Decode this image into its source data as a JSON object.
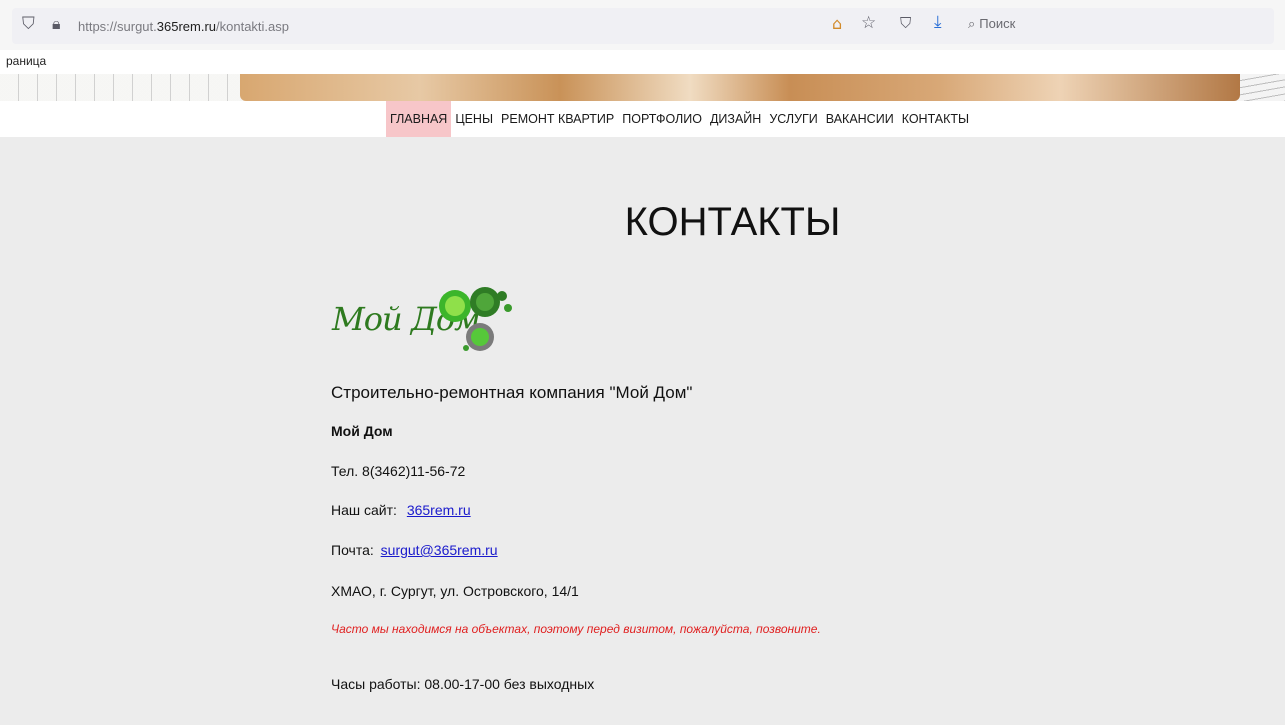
{
  "browser": {
    "url_prefix": "https://surgut.",
    "url_domain": "365rem.ru",
    "url_path": "/kontakti.asp",
    "search_placeholder": "Поиск",
    "tab_fragment": "раница"
  },
  "nav": {
    "items": [
      {
        "label": "ГЛАВНАЯ",
        "active": true
      },
      {
        "label": "ЦЕНЫ"
      },
      {
        "label": "РЕМОНТ КВАРТИР"
      },
      {
        "label": "ПОРТФОЛИО"
      },
      {
        "label": "ДИЗАЙН"
      },
      {
        "label": "УСЛУГИ"
      },
      {
        "label": "ВАКАНСИИ"
      },
      {
        "label": "КОНТАКТЫ"
      }
    ],
    "active_color": "#f7c6c9"
  },
  "page": {
    "title": "КОНТАКТЫ",
    "logo_text": "Мой Дом",
    "company": "Строительно-ремонтная компания \"Мой Дом\"",
    "name": "Мой Дом",
    "phone": "Тел. 8(3462)11-56-72",
    "site_label": "Наш сайт:",
    "site_link": "365rem.ru",
    "mail_label": "Почта:",
    "mail_link": "surgut@365rem.ru",
    "address": "ХМАО, г. Сургут, ул. Островского, 14/1",
    "note": "Часто мы находимся на объектах, поэтому перед визитом, пожалуйста, позвоните.",
    "hours": "Часы работы: 08.00-17-00 без выходных"
  },
  "colors": {
    "note_red": "#e02020",
    "link_blue": "#1a1acc",
    "logo_green": "#2e7a1f"
  }
}
